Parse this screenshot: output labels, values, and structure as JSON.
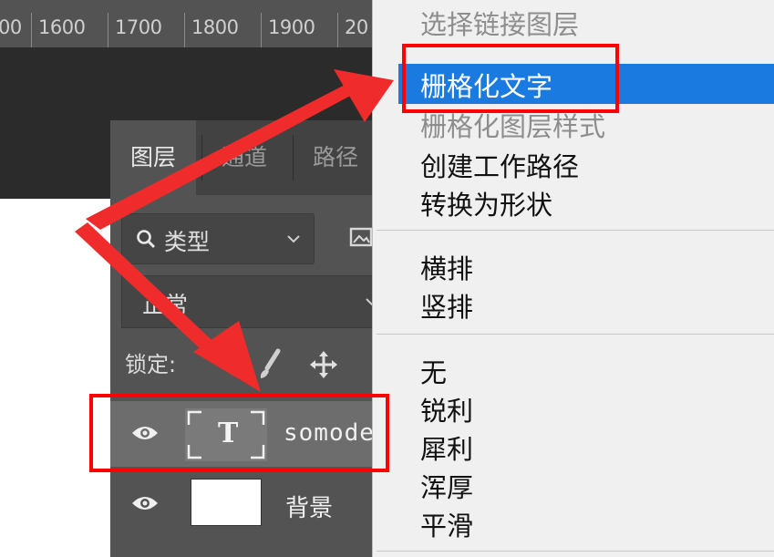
{
  "ruler": {
    "labels": [
      "00",
      "1600",
      "1700",
      "1800",
      "1900",
      "20"
    ]
  },
  "layers_panel": {
    "tabs": [
      "图层",
      "通道",
      "路径"
    ],
    "filter_label": "类型",
    "blend_mode": "正常",
    "lock_label": "锁定:",
    "layers": [
      {
        "name": "somode",
        "kind": "text",
        "thumb_glyph": "T",
        "selected": true
      },
      {
        "name": "背景",
        "kind": "background",
        "selected": false
      }
    ]
  },
  "context_menu": {
    "items": [
      {
        "label": "选择链接图层",
        "disabled": true
      },
      {
        "label": "栅格化文字",
        "highlighted": true
      },
      {
        "label": "栅格化图层样式",
        "disabled": true
      },
      {
        "label": "创建工作路径"
      },
      {
        "label": "转换为形状"
      },
      {
        "label": "横排"
      },
      {
        "label": "竖排"
      },
      {
        "label": "无"
      },
      {
        "label": "锐利"
      },
      {
        "label": "犀利"
      },
      {
        "label": "浑厚"
      },
      {
        "label": "平滑"
      }
    ]
  },
  "colors": {
    "highlight": "#1a7ae0",
    "annotation_red": "#ff0000",
    "panel_bg": "#535353"
  },
  "icons": [
    "search-icon",
    "chevron-down-icon",
    "image-filter-icon",
    "brush-lock-icon",
    "move-lock-icon",
    "eye-icon",
    "text-layer-icon"
  ]
}
